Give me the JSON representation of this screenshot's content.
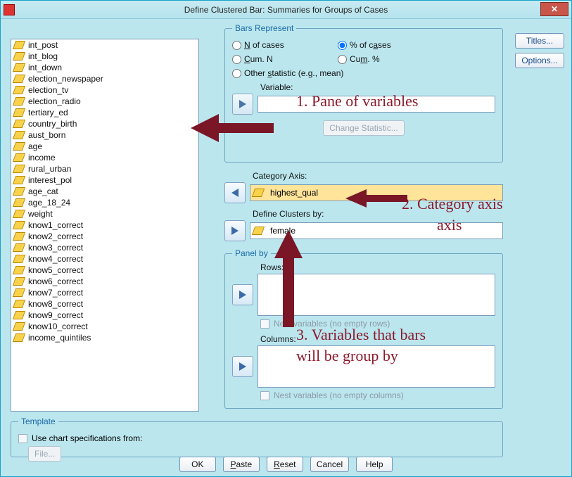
{
  "window": {
    "title": "Define Clustered Bar: Summaries for Groups of Cases"
  },
  "rightButtons": {
    "titles": "Titles...",
    "options": "Options..."
  },
  "variables": [
    "int_post",
    "int_blog",
    "int_down",
    "election_newspaper",
    "election_tv",
    "election_radio",
    "tertiary_ed",
    "country_birth",
    "aust_born",
    "age",
    "income",
    "rural_urban",
    "interest_pol",
    "age_cat",
    "age_18_24",
    "weight",
    "know1_correct",
    "know2_correct",
    "know3_correct",
    "know4_correct",
    "know5_correct",
    "know6_correct",
    "know7_correct",
    "know8_correct",
    "know9_correct",
    "know10_correct",
    "income_quintiles"
  ],
  "barsRepresent": {
    "legend": "Bars Represent",
    "n_of_cases_html": "<span class='ul'>N</span> of cases",
    "pct_of_cases_html": "% of c<span class='ul'>a</span>ses",
    "cum_n_html": "<span class='ul'>C</span>um. N",
    "cum_pct_html": "Cu<span class='ul'>m</span>. %",
    "other_stat_html": "Other <span class='ul'>s</span>tatistic (e.g., mean)",
    "selected": "pct_of_cases",
    "variable_label": "Variable:",
    "change_stat_html": "C<span class='ul'>h</span>ange Statistic..."
  },
  "categoryAxis": {
    "label": "Category Axis:",
    "value": "highest_qual"
  },
  "clusters": {
    "label_html": "Define Clusters <span class='ul'>b</span>y:",
    "value": "female"
  },
  "panelBy": {
    "legend": "Panel by",
    "rows_label_html": "Ro<span class='ul'>w</span>s:",
    "nest_rows_html": "N<span class='ul'>e</span>st variables (no empty rows)",
    "cols_label_html": "Co<span class='ul'>l</span>umns:",
    "nest_cols_html": "Nes<span class='ul'>t</span> variables (no empty columns)"
  },
  "template": {
    "legend": "Template",
    "use_html": "<span class='ul'>U</span>se chart specifications from:",
    "file_btn": "File..."
  },
  "bottom": {
    "ok": "OK",
    "paste_html": "<span class='ul'>P</span>aste",
    "reset_html": "<span class='ul'>R</span>eset",
    "cancel": "Cancel",
    "help": "Help"
  },
  "annotations": {
    "a1": "1. Pane of variables",
    "a2": "2. Category axis",
    "a3a": "3. Variables that bars",
    "a3b": "will be group by"
  }
}
